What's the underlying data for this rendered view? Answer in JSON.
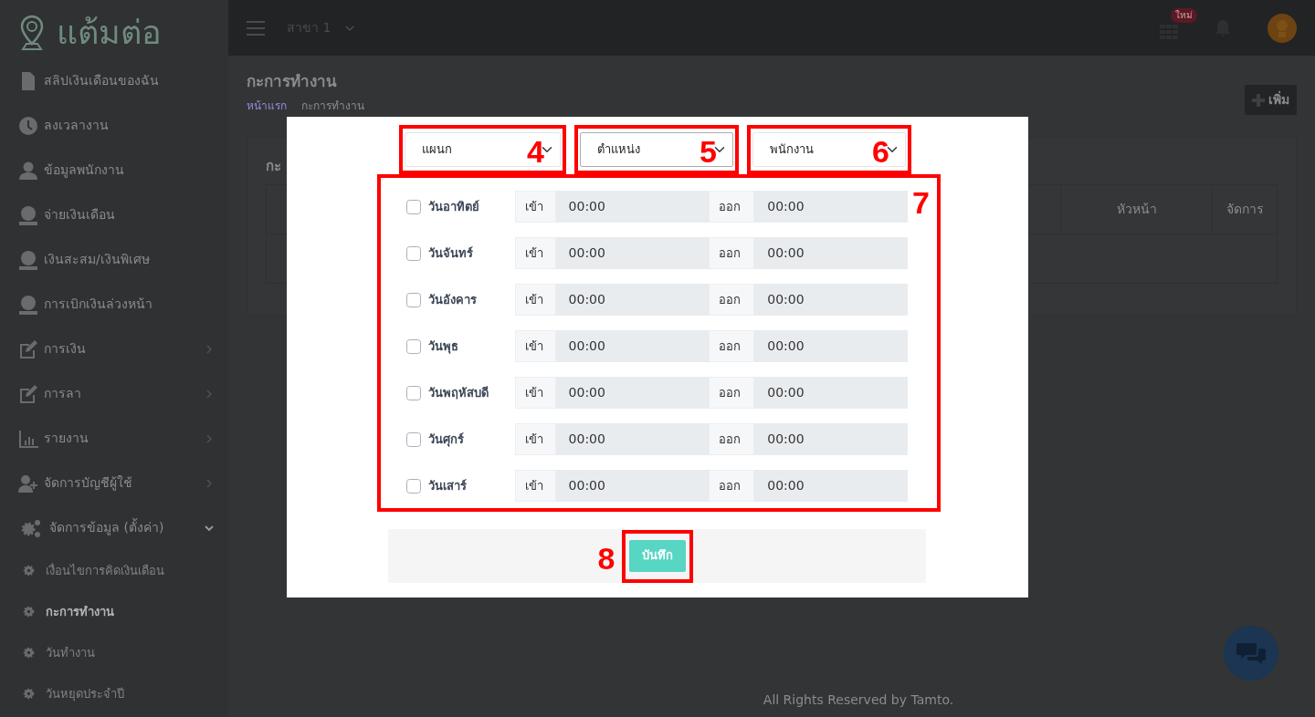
{
  "sidebar": {
    "logo": "แต้มต่อ",
    "items": [
      {
        "label": "สลิปเงินเดือนของฉัน"
      },
      {
        "label": "ลงเวลางาน"
      },
      {
        "label": "ข้อมูลพนักงาน"
      },
      {
        "label": "จ่ายเงินเดือน"
      },
      {
        "label": "เงินสะสม/เงินพิเศษ"
      },
      {
        "label": "การเบิกเงินล่วงหน้า"
      },
      {
        "label": "การเงิน",
        "expanded": false
      },
      {
        "label": "การลา",
        "expanded": false
      },
      {
        "label": "รายงาน",
        "expanded": false
      },
      {
        "label": "จัดการบัญชีผู้ใช้",
        "expanded": false
      },
      {
        "label": "จัดการข้อมูล (ตั้งค่า)",
        "expanded": true,
        "children": [
          {
            "label": "เงื่อนไขการคิดเงินเดือน",
            "selected": false
          },
          {
            "label": "กะการทำงาน",
            "selected": true
          },
          {
            "label": "วันทำงาน",
            "selected": false
          },
          {
            "label": "วันหยุดประจำปี",
            "selected": false
          }
        ]
      }
    ]
  },
  "topbar": {
    "branch": "สาขา 1",
    "apps_badge": "ใหม่"
  },
  "page": {
    "title": "กะการทำงาน",
    "breadcrumb": [
      "หน้าแรก",
      "กะการทำงาน"
    ],
    "add_button": "เพิ่ม"
  },
  "table": {
    "title": "กะ",
    "columns": [
      "หัวหน้า",
      "จัดการ"
    ]
  },
  "modal": {
    "selects": [
      {
        "value": "แผนก",
        "focused": false,
        "annotation": "4"
      },
      {
        "value": "ตำแหน่ง",
        "focused": true,
        "annotation": "5"
      },
      {
        "value": "พนักงาน",
        "focused": false,
        "annotation": "6"
      }
    ],
    "days_annotation": "7",
    "days": [
      {
        "label": "วันอาทิตย์",
        "checked": false,
        "in_label": "เข้า",
        "in_value": "00:00",
        "out_label": "ออก",
        "out_value": "00:00"
      },
      {
        "label": "วันจันทร์",
        "checked": false,
        "in_label": "เข้า",
        "in_value": "00:00",
        "out_label": "ออก",
        "out_value": "00:00"
      },
      {
        "label": "วันอังคาร",
        "checked": false,
        "in_label": "เข้า",
        "in_value": "00:00",
        "out_label": "ออก",
        "out_value": "00:00"
      },
      {
        "label": "วันพุธ",
        "checked": false,
        "in_label": "เข้า",
        "in_value": "00:00",
        "out_label": "ออก",
        "out_value": "00:00"
      },
      {
        "label": "วันพฤหัสบดี",
        "checked": false,
        "in_label": "เข้า",
        "in_value": "00:00",
        "out_label": "ออก",
        "out_value": "00:00"
      },
      {
        "label": "วันศุกร์",
        "checked": false,
        "in_label": "เข้า",
        "in_value": "00:00",
        "out_label": "ออก",
        "out_value": "00:00"
      },
      {
        "label": "วันเสาร์",
        "checked": false,
        "in_label": "เข้า",
        "in_value": "00:00",
        "out_label": "ออก",
        "out_value": "00:00"
      }
    ],
    "save_button": "บันทึก",
    "save_annotation": "8"
  },
  "footer": "All Rights Reserved by Tamto."
}
